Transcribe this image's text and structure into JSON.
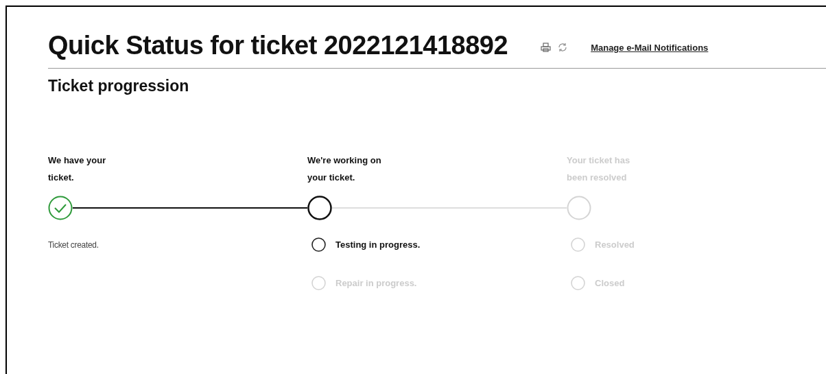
{
  "header": {
    "title": "Quick Status for ticket 2022121418892",
    "link": "Manage e-Mail Notifications"
  },
  "section_title": "Ticket progression",
  "steps": [
    {
      "title": "We have your ticket.",
      "kind": "done",
      "details": [
        {
          "kind": "note",
          "text": "Ticket created."
        }
      ]
    },
    {
      "title": "We're working on your ticket.",
      "kind": "current",
      "details": [
        {
          "kind": "item",
          "text": "Testing in progress.",
          "active": true
        },
        {
          "kind": "item",
          "text": "Repair in progress.",
          "active": false
        }
      ]
    },
    {
      "title": "Your ticket has been resolved",
      "kind": "pending",
      "details": [
        {
          "kind": "item",
          "text": "Resolved",
          "active": false
        },
        {
          "kind": "item",
          "text": "Closed",
          "active": false
        }
      ]
    }
  ]
}
